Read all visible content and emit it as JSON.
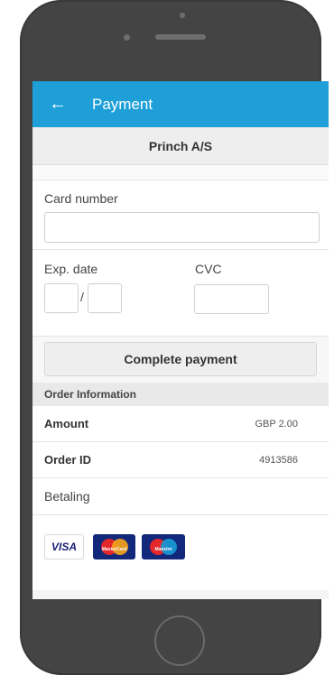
{
  "appbar": {
    "back_icon": "arrow-left-icon",
    "title": "Payment"
  },
  "merchant": {
    "name": "Princh A/S"
  },
  "card": {
    "card_number_label": "Card number",
    "card_number_value": "",
    "exp_date_label": "Exp. date",
    "exp_month_value": "",
    "exp_separator": "/",
    "exp_year_value": "",
    "cvc_label": "CVC",
    "cvc_value": ""
  },
  "actions": {
    "complete_label": "Complete payment"
  },
  "order": {
    "header": "Order Information",
    "rows": [
      {
        "key": "Amount",
        "value": "GBP 2.00"
      },
      {
        "key": "Order ID",
        "value": "4913586"
      }
    ],
    "betaling": "Betaling"
  },
  "logos": {
    "visa": "VISA",
    "mastercard": "MasterCard",
    "maestro": "Maestro"
  },
  "colors": {
    "appbar": "#1e9fd8",
    "phone_body": "#444444"
  }
}
